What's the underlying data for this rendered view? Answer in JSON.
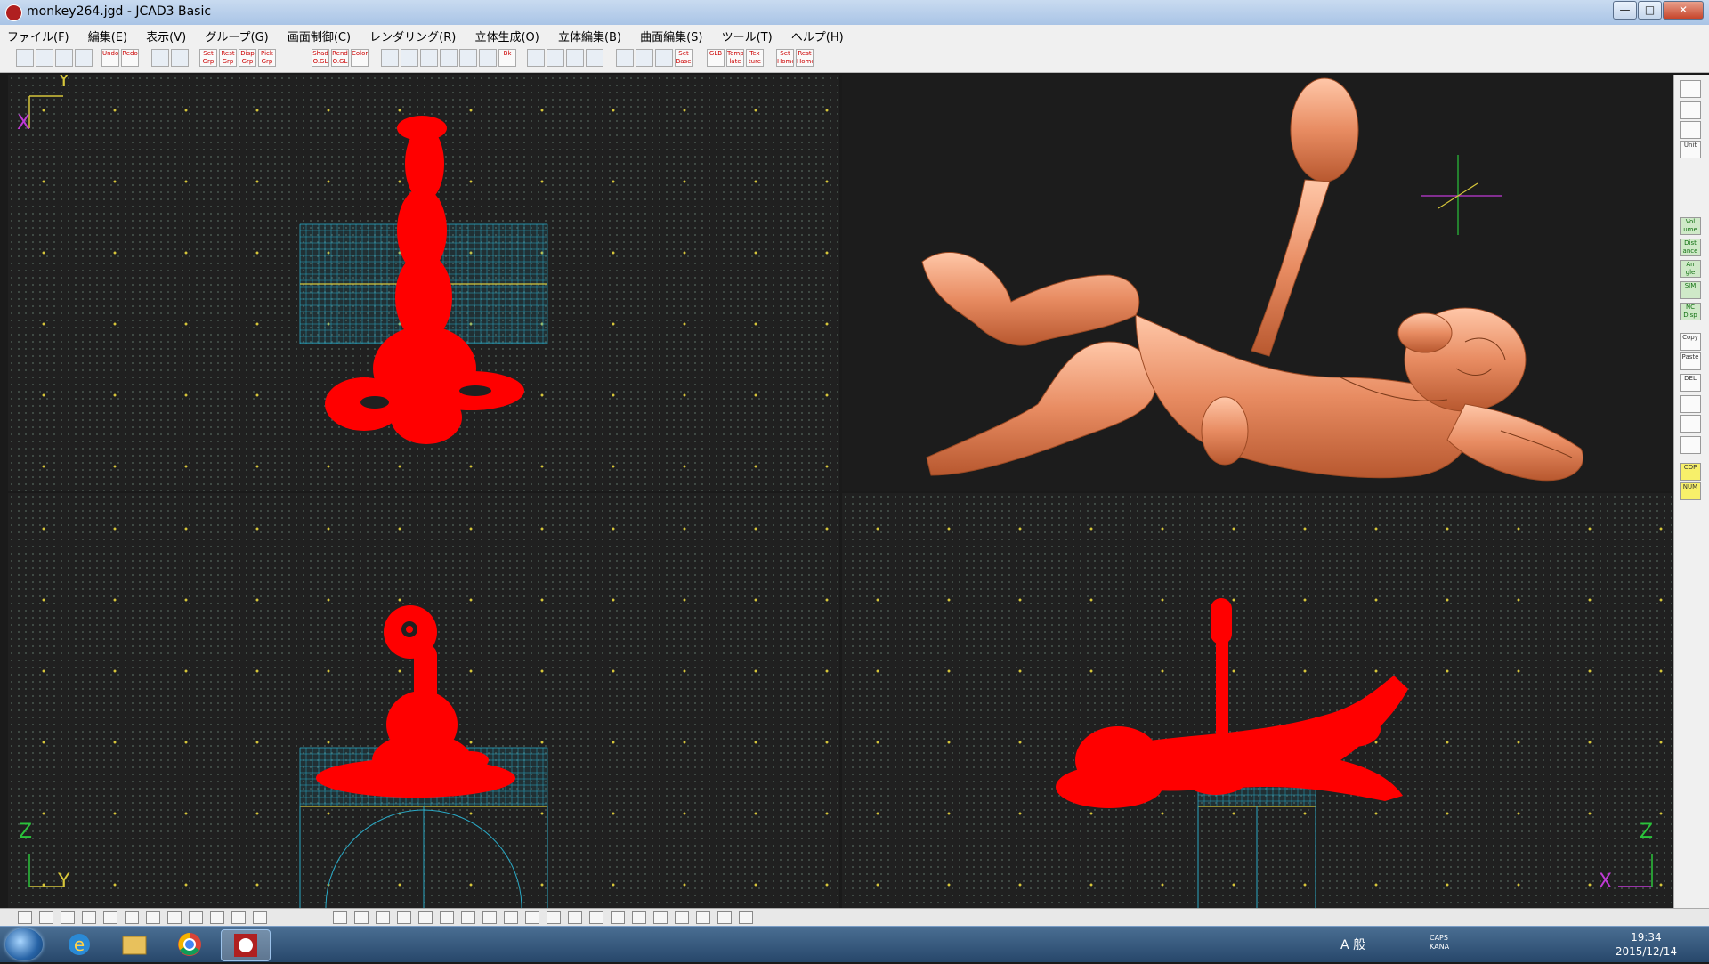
{
  "window": {
    "title": "monkey264.jgd - JCAD3 Basic",
    "buttons": {
      "minimize": "—",
      "maximize": "□",
      "close": "✕"
    }
  },
  "menu": [
    "ファイル(F)",
    "編集(E)",
    "表示(V)",
    "グループ(G)",
    "画面制御(C)",
    "レンダリング(R)",
    "立体生成(O)",
    "立体編集(B)",
    "曲面編集(S)",
    "ツール(T)",
    "ヘルプ(H)"
  ],
  "toolbar": {
    "buttons": [
      {
        "label": "",
        "icon": "new-file-icon"
      },
      {
        "label": "",
        "icon": "open-folder-icon"
      },
      {
        "label": "",
        "icon": "save-icon"
      },
      {
        "label": "",
        "icon": "print-icon"
      },
      {
        "label": "Undo",
        "icon": "undo-icon"
      },
      {
        "label": "Redo",
        "icon": "redo-icon"
      },
      {
        "label": "",
        "icon": "group-icon"
      },
      {
        "label": "",
        "icon": "group2-icon"
      },
      {
        "label": "Set Grp",
        "icon": "set-group-icon"
      },
      {
        "label": "Rest Grp",
        "icon": "reset-group-icon"
      },
      {
        "label": "Disp Grp",
        "icon": "display-group-icon"
      },
      {
        "label": "Pick Grp",
        "icon": "pick-group-icon"
      },
      {
        "label": "Shad O.GL",
        "icon": "shade-icon"
      },
      {
        "label": "Rend O.GL",
        "icon": "render-icon"
      },
      {
        "label": "Color",
        "icon": "color-icon"
      },
      {
        "label": "",
        "icon": "zoom-in-icon"
      },
      {
        "label": "",
        "icon": "zoom-out-icon"
      },
      {
        "label": "",
        "icon": "zoom-fit-icon"
      },
      {
        "label": "",
        "icon": "zoom-window-icon"
      },
      {
        "label": "",
        "icon": "zoom-all-icon"
      },
      {
        "label": "",
        "icon": "pan-hand-icon"
      },
      {
        "label": "Bk",
        "icon": "back-icon"
      },
      {
        "label": "",
        "icon": "rotate-icon"
      },
      {
        "label": "",
        "icon": "rotate2-icon"
      },
      {
        "label": "",
        "icon": "view-icon"
      },
      {
        "label": "",
        "icon": "frame-icon"
      },
      {
        "label": "",
        "icon": "grid-icon"
      },
      {
        "label": "",
        "icon": "dot-grid-icon"
      },
      {
        "label": "",
        "icon": "snap-icon"
      },
      {
        "label": "Set Base",
        "icon": "set-base-icon"
      },
      {
        "label": "GLB",
        "icon": "glb-icon"
      },
      {
        "label": "Temp late",
        "icon": "template-icon"
      },
      {
        "label": "Tex ture",
        "icon": "texture-icon"
      },
      {
        "label": "Set Home",
        "icon": "set-home-icon"
      },
      {
        "label": "Rest Home",
        "icon": "reset-home-icon"
      }
    ]
  },
  "viewports": {
    "top_left": {
      "axis_h": "Y",
      "axis_v": "X"
    },
    "bottom_left": {
      "axis_h": "Y",
      "axis_v": "Z"
    },
    "bottom_right": {
      "axis_h": "X",
      "axis_v": "Z"
    }
  },
  "sidepanel": {
    "buttons": [
      {
        "label": "",
        "icon": "camera-icon",
        "style": "normal"
      },
      {
        "label": "",
        "icon": "monitor-icon",
        "style": "normal"
      },
      {
        "label": "",
        "icon": "layer-icon",
        "style": "normal"
      },
      {
        "label": "Unit",
        "icon": "unit-icon",
        "style": "normal"
      },
      {
        "label": "Vol ume",
        "icon": "volume-icon",
        "style": "green"
      },
      {
        "label": "Dist ance",
        "icon": "distance-icon",
        "style": "green"
      },
      {
        "label": "An gle",
        "icon": "angle-icon",
        "style": "green"
      },
      {
        "label": "SIM",
        "icon": "sim-icon",
        "style": "green"
      },
      {
        "label": "NC Disp",
        "icon": "nc-icon",
        "style": "green"
      },
      {
        "label": "Copy",
        "icon": "copy-icon",
        "style": "normal"
      },
      {
        "label": "Paste",
        "icon": "paste-icon",
        "style": "normal"
      },
      {
        "label": "DEL",
        "icon": "delete-icon",
        "style": "normal"
      },
      {
        "label": "",
        "icon": "table-icon",
        "style": "normal"
      },
      {
        "label": "",
        "icon": "palette-icon",
        "style": "normal"
      },
      {
        "label": "",
        "icon": "list-icon",
        "style": "normal"
      },
      {
        "label": "COP",
        "icon": "cop-icon",
        "style": "yellow"
      },
      {
        "label": "NUM",
        "icon": "num-icon",
        "style": "yellow"
      }
    ]
  },
  "taskbar": {
    "apps": [
      {
        "name": "internet-explorer-icon"
      },
      {
        "name": "file-explorer-icon"
      },
      {
        "name": "chrome-icon"
      },
      {
        "name": "jcad3-icon"
      }
    ],
    "ime": "A 般",
    "caps": "CAPS KANA",
    "time": "19:34",
    "date": "2015/12/14"
  },
  "colors": {
    "model_red": "#ff0000",
    "model_copper": "#e88c62",
    "grid_cyan": "#2aa8c4",
    "axis_yellow": "#d6c63a",
    "axis_magenta": "#c03ad6"
  }
}
